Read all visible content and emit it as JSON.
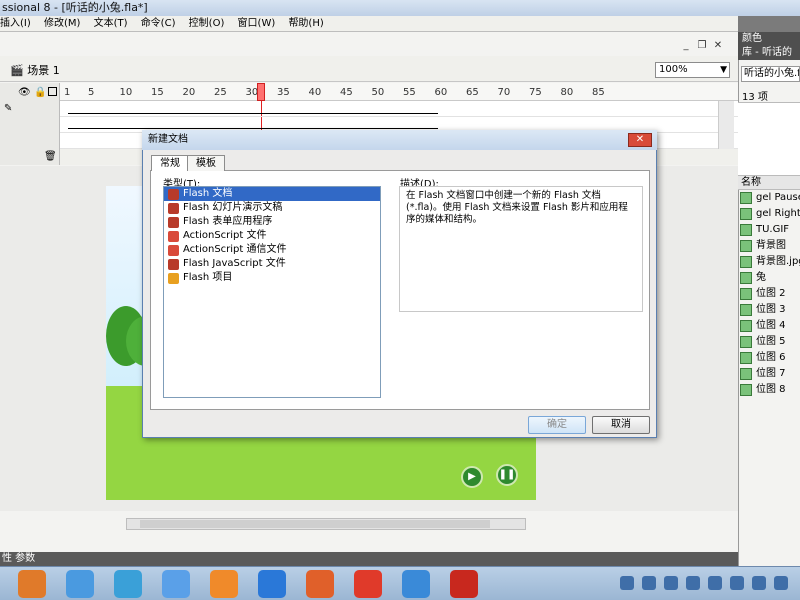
{
  "window": {
    "title": "ssional 8 - [听话的小兔.fla*]"
  },
  "menu": [
    "插入(I)",
    "修改(M)",
    "文本(T)",
    "命令(C)",
    "控制(O)",
    "窗口(W)",
    "帮助(H)"
  ],
  "scene": {
    "label": "场景 1",
    "zoom": "100%"
  },
  "timeline": {
    "ruler_ticks": [
      "1",
      "5",
      "10",
      "15",
      "20",
      "25",
      "30",
      "35",
      "40",
      "45",
      "50",
      "55",
      "60",
      "65",
      "70",
      "75",
      "80",
      "85"
    ],
    "current_frame": 30
  },
  "properties_bar": "性  参数",
  "right_panel": {
    "colors_title": "颜色",
    "library_title": "库 - 听话的",
    "library_doc": "听话的小兔.fla",
    "library_count": "13 项",
    "name_header": "名称",
    "items": [
      {
        "name": "gel Pause",
        "icon": "button-icon"
      },
      {
        "name": "gel Right",
        "icon": "button-icon"
      },
      {
        "name": "TU.GIF",
        "icon": "bitmap-icon"
      },
      {
        "name": "背景图",
        "icon": "bitmap-icon"
      },
      {
        "name": "背景图.jpg",
        "icon": "bitmap-icon"
      },
      {
        "name": "兔",
        "icon": "movieclip-icon"
      },
      {
        "name": "位图 2",
        "icon": "bitmap-icon"
      },
      {
        "name": "位图 3",
        "icon": "bitmap-icon"
      },
      {
        "name": "位图 4",
        "icon": "bitmap-icon"
      },
      {
        "name": "位图 5",
        "icon": "bitmap-icon"
      },
      {
        "name": "位图 6",
        "icon": "bitmap-icon"
      },
      {
        "name": "位图 7",
        "icon": "bitmap-icon"
      },
      {
        "name": "位图 8",
        "icon": "bitmap-icon"
      }
    ]
  },
  "dialog": {
    "title": "新建文档",
    "tabs": [
      "常规",
      "模板"
    ],
    "type_label": "类型(T):",
    "desc_label": "描述(D):",
    "types": [
      {
        "label": "Flash 文档",
        "selected": true
      },
      {
        "label": "Flash 幻灯片演示文稿",
        "selected": false
      },
      {
        "label": "Flash 表单应用程序",
        "selected": false
      },
      {
        "label": "ActionScript 文件",
        "selected": false
      },
      {
        "label": "ActionScript 通信文件",
        "selected": false
      },
      {
        "label": "Flash JavaScript 文件",
        "selected": false
      },
      {
        "label": "Flash 项目",
        "selected": false
      }
    ],
    "description": "在 Flash 文档窗口中创建一个新的 Flash 文档 (*.fla)。使用 Flash 文档来设置 Flash 影片和应用程序的媒体和结构。",
    "ok": "确定",
    "cancel": "取消"
  },
  "colors": {
    "selection": "#3169c6",
    "grass": "#94d642",
    "panel_header": "#4f4f4f"
  }
}
